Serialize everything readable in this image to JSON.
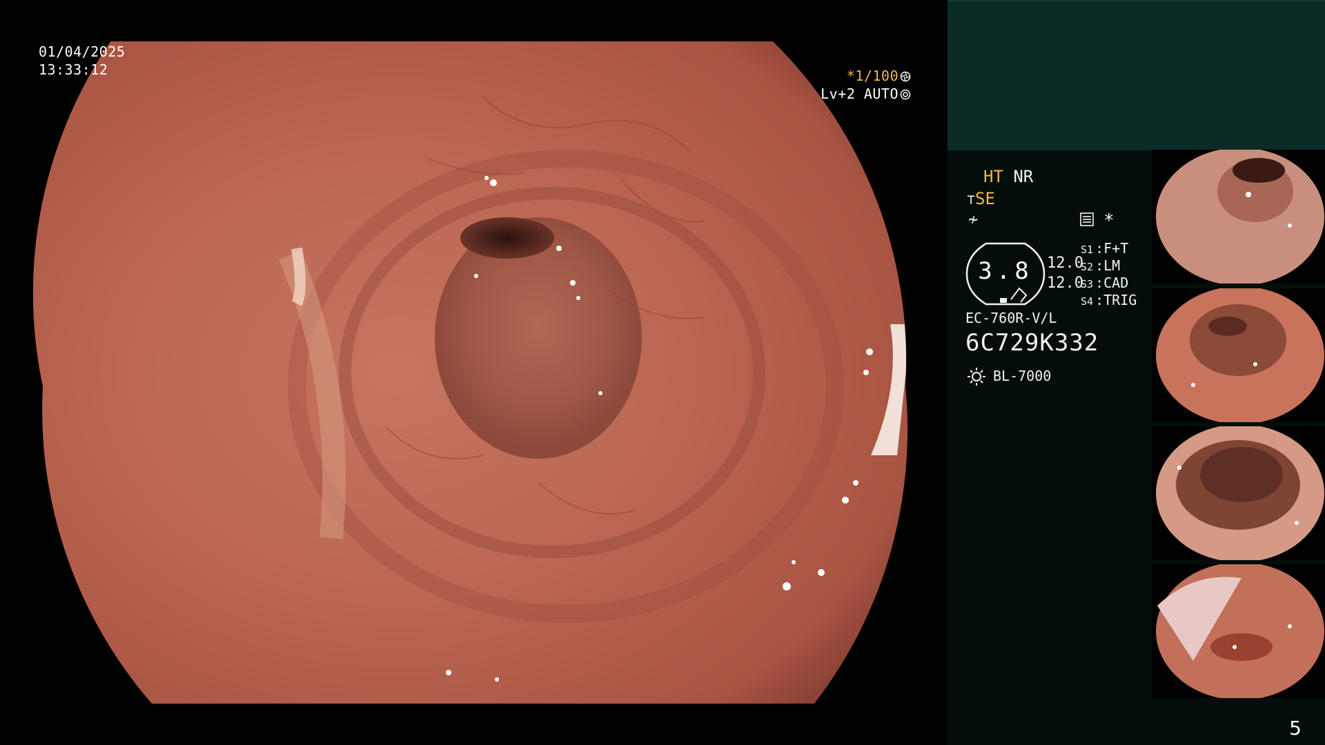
{
  "overlay": {
    "date": "01/04/2025",
    "time": "13:33:12",
    "shutter": "*1/100",
    "iris": "Lv+2 AUTO"
  },
  "panel": {
    "ht": "HT",
    "nr": "NR",
    "se": "SE",
    "freeze_glyph": "≁",
    "asterisk": "*",
    "gauge_value": "3.8",
    "gauge_r1": "12.0",
    "gauge_r2": "12.0",
    "switches": [
      {
        "key": "S1",
        "label": "F+T"
      },
      {
        "key": "S2",
        "label": "LM"
      },
      {
        "key": "S3",
        "label": "CAD"
      },
      {
        "key": "S4",
        "label": "TRIG"
      }
    ],
    "scope_model": "EC-760R-V/L",
    "serial": "6C729K332",
    "light_source": "BL-7000",
    "page_number": "5"
  },
  "icons": {
    "exposure": "aperture-icon",
    "iris": "iris-icon",
    "se": "structure-enhance-icon",
    "settings": "settings-list-icon",
    "light": "light-source-icon"
  },
  "colors": {
    "accent": "#f3b942",
    "panel_bg": "#030e0c",
    "panel_top": "#0b2b27",
    "mucosa": "#b8624f"
  }
}
